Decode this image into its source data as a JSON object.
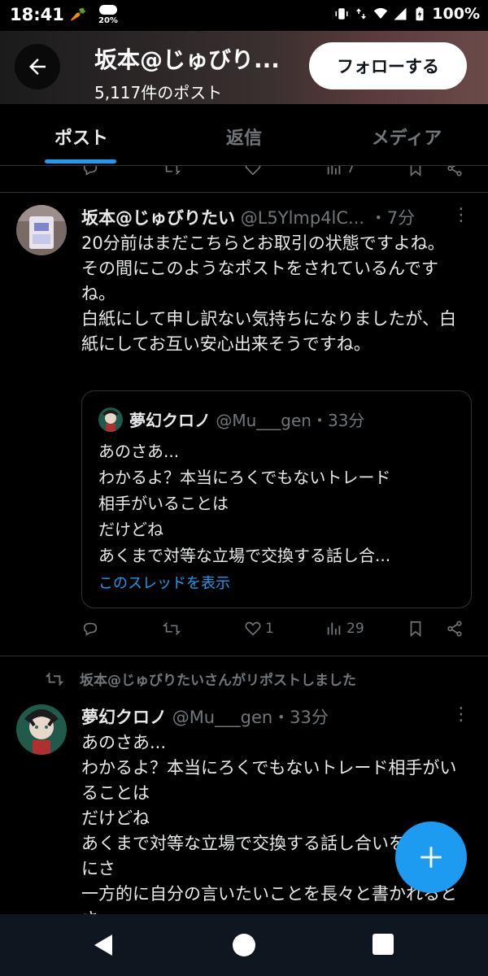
{
  "status_bar": {
    "time": "18:41",
    "weather_pct": "20%",
    "battery": "100%"
  },
  "header": {
    "title": "坂本@じゅびり...",
    "post_count": "5,117件のポスト",
    "follow_label": "フォローする"
  },
  "tabs": [
    {
      "label": "ポスト",
      "active": true
    },
    {
      "label": "返信",
      "active": false
    },
    {
      "label": "メディア",
      "active": false
    }
  ],
  "prev_tweet": {
    "views": "7"
  },
  "tweet1": {
    "name": "坂本@じゅびりたい",
    "handle": "@L5Ylmp4lC...",
    "time": "・7分",
    "body": "20分前はまだこちらとお取引の状態ですよね。\nその間にこのようなポストをされているんですね。\n白紙にして申し訳ない気持ちになりましたが、白紙にしてお互い安心出来そうですね。",
    "quote": {
      "name": "夢幻クロノ",
      "handle": "@Mu___gen",
      "time": "・33分",
      "body": "あのさあ...\nわかるよ？本当にろくでもないトレード\n相手がいることは\nだけどね\nあくまで対等な立場で交換する話し合...",
      "link": "このスレッドを表示"
    },
    "likes": "1",
    "views": "29"
  },
  "repost_notice": "坂本@じゅびりたいさんがリポストしました",
  "tweet2": {
    "name": "夢幻クロノ",
    "handle": "@Mu___gen",
    "time": "・33分",
    "body": "あのさあ...\nわかるよ？本当にろくでもないトレード相手がいることは\nだけどね\nあくまで対等な立場で交換する話し合いをするのにさ\n一方的に自分の言いたいことを長々と書かれるとさ"
  },
  "colors": {
    "accent": "#1d9bf0",
    "background": "#000000",
    "muted": "#71767b"
  }
}
